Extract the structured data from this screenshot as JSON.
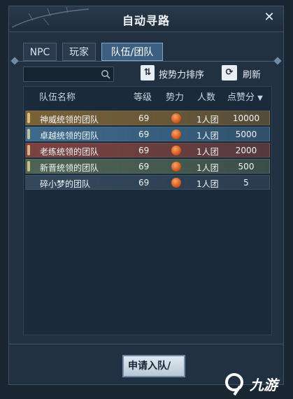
{
  "window": {
    "title": "自动寻路"
  },
  "tabs": [
    {
      "label": "NPC"
    },
    {
      "label": "玩家"
    },
    {
      "label": "队伍/团队"
    }
  ],
  "search": {
    "value": "",
    "placeholder": ""
  },
  "toolbar": {
    "sort_label": "按势力排序",
    "refresh_label": "刷新"
  },
  "table": {
    "headers": {
      "name": "队伍名称",
      "level": "等级",
      "power": "势力",
      "members": "人数",
      "likes": "点赞分"
    },
    "rows": [
      {
        "name": "神威统领的团队",
        "level": "69",
        "members": "1人团",
        "likes": "10000",
        "color": "#7a6238"
      },
      {
        "name": "卓越统领的团队",
        "level": "69",
        "members": "1人团",
        "likes": "5000",
        "color": "#3e6a8c"
      },
      {
        "name": "老练统领的团队",
        "level": "69",
        "members": "1人团",
        "likes": "2000",
        "color": "#7a4340"
      },
      {
        "name": "新晋统领的团队",
        "level": "69",
        "members": "1人团",
        "likes": "500",
        "color": "#4f6553"
      },
      {
        "name": "碎小梦的团队",
        "level": "69",
        "members": "1人团",
        "likes": "5",
        "color": "#34485c"
      }
    ]
  },
  "apply_button": {
    "label": "申请入队/"
  },
  "watermark": {
    "text": "九游"
  }
}
